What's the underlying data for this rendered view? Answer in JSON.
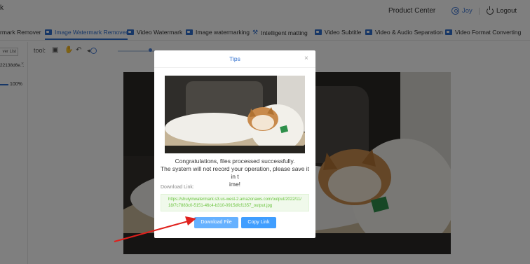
{
  "header": {
    "brand": "k",
    "product_center": "Product Center",
    "user_name": "Joy",
    "logout_label": "Logout"
  },
  "tabs": [
    {
      "label": "rmark Remover",
      "active": false,
      "icon": "none"
    },
    {
      "label": "Image Watermark Remover",
      "active": true,
      "icon": "image-icon"
    },
    {
      "label": "Video Watermark",
      "active": false,
      "icon": "video-icon"
    },
    {
      "label": "Image watermarking",
      "active": false,
      "icon": "image-icon"
    },
    {
      "label": "Intelligent matting",
      "active": false,
      "icon": "wand-icon"
    },
    {
      "label": "Video Subtitle",
      "active": false,
      "icon": "video-icon"
    },
    {
      "label": "Video & Audio Separation",
      "active": false,
      "icon": "video-icon"
    },
    {
      "label": "Video Format Converting",
      "active": false,
      "icon": "video-icon"
    }
  ],
  "toolbar": {
    "tool_label": "tool:"
  },
  "sidebar": {
    "list_button": "ver List",
    "file_name": "22138d6e...",
    "progress_pct": "100%",
    "progress_value": 100
  },
  "modal": {
    "title": "Tips",
    "message_line1": "Congratulations, files processed successfully.",
    "message_line2": "The system will not record your operation, please save it in t",
    "message_line3": "ime!",
    "download_label": "Download Link:",
    "download_url": "https://shuiyinwatermark.s3.us-west-2.amazonaws.com/output/2022/11/18/7c7883c0-5151-46c4-b310-0915dfcf1357_output.jpg",
    "download_button": "Download File",
    "copy_button": "Copy Link"
  },
  "colors": {
    "accent": "#2f6fce",
    "link_green": "#67c23a",
    "arrow": "#e0201c"
  }
}
